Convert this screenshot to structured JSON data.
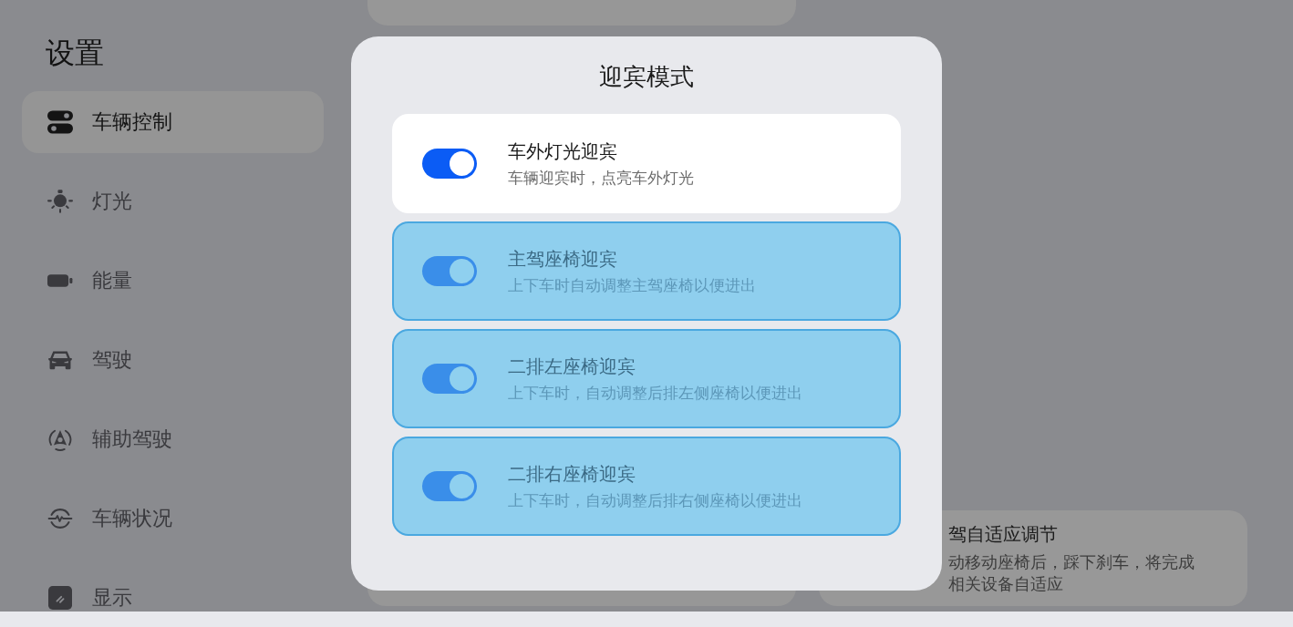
{
  "sidebar": {
    "title": "设置",
    "items": [
      {
        "label": "车辆控制",
        "selected": true
      },
      {
        "label": "灯光",
        "selected": false
      },
      {
        "label": "能量",
        "selected": false
      },
      {
        "label": "驾驶",
        "selected": false
      },
      {
        "label": "辅助驾驶",
        "selected": false
      },
      {
        "label": "车辆状况",
        "selected": false
      },
      {
        "label": "显示",
        "selected": false
      }
    ]
  },
  "content": {
    "card": {
      "title": "驾自适应调节",
      "description_lines": [
        "动移动座椅后，踩下刹车，将完成",
        "相关设备自适应"
      ]
    }
  },
  "dialog": {
    "title": "迎宾模式",
    "options": [
      {
        "title": "车外灯光迎宾",
        "description": "车辆迎宾时，点亮车外灯光",
        "on": true,
        "highlighted": false
      },
      {
        "title": "主驾座椅迎宾",
        "description": "上下车时自动调整主驾座椅以便进出",
        "on": true,
        "highlighted": true
      },
      {
        "title": "二排左座椅迎宾",
        "description": "上下车时，自动调整后排左侧座椅以便进出",
        "on": true,
        "highlighted": true
      },
      {
        "title": "二排右座椅迎宾",
        "description": "上下车时，自动调整后排右侧座椅以便进出",
        "on": true,
        "highlighted": true
      }
    ]
  }
}
